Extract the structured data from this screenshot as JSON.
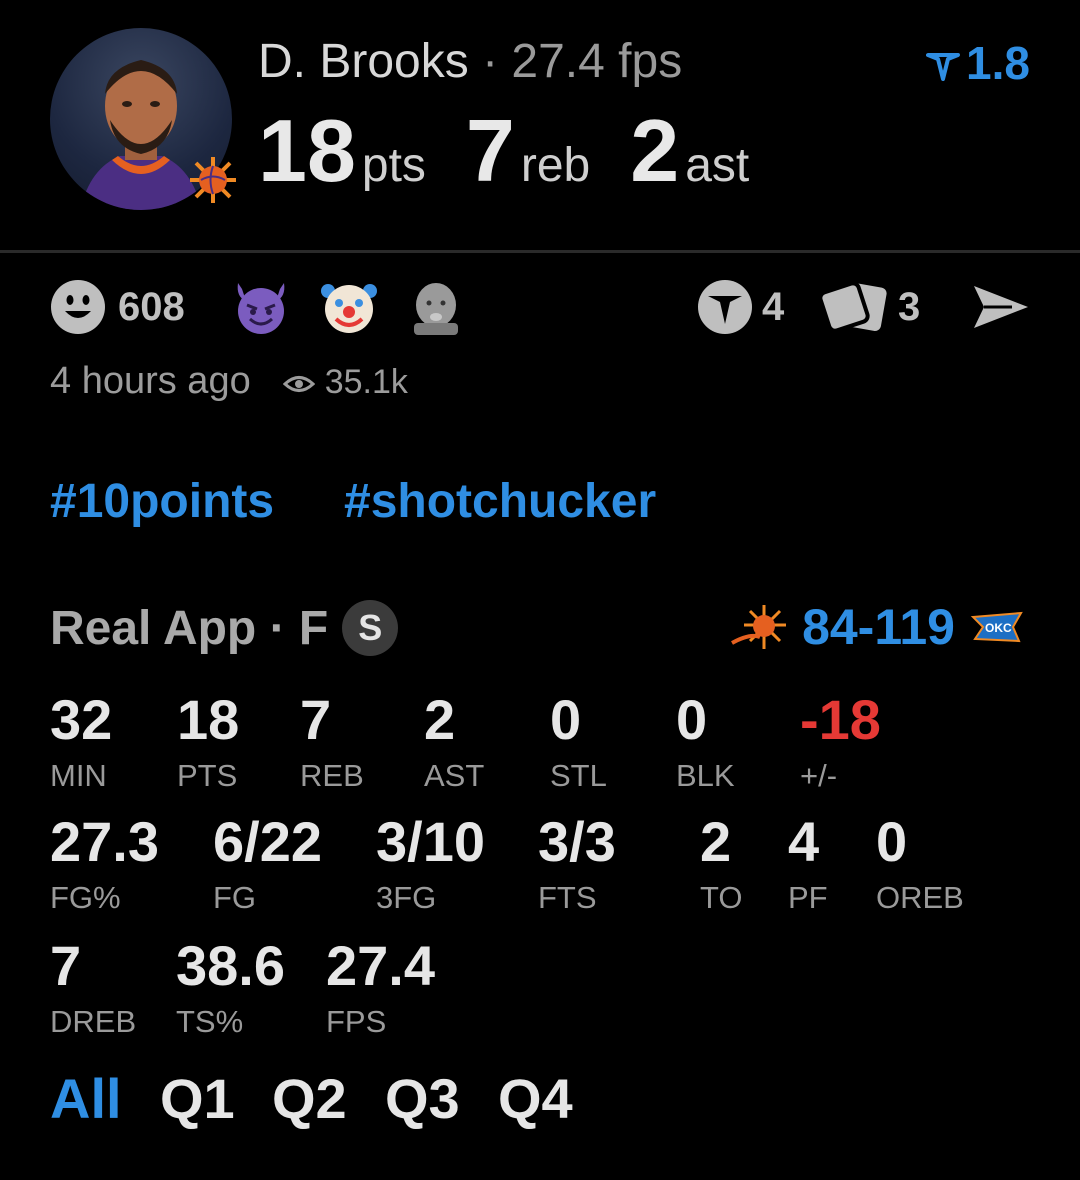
{
  "header": {
    "player_name": "D. Brooks",
    "separator": "·",
    "fps_text": "27.4 fps",
    "rating": "1.8",
    "points": "18",
    "points_unit": "pts",
    "rebounds": "7",
    "rebounds_unit": "reb",
    "assists": "2",
    "assists_unit": "ast"
  },
  "reactions": {
    "smile_count": "608",
    "emojis": [
      "devil-emoji",
      "clown-emoji",
      "baby-emoji"
    ],
    "comments_count": "4",
    "cards_count": "3"
  },
  "meta": {
    "time_ago": "4 hours ago",
    "views": "35.1k"
  },
  "hashtags": [
    "#10points",
    "#shotchucker"
  ],
  "game": {
    "source": "Real App · F",
    "badge": "S",
    "score": "84-119",
    "home_team": "phoenix-suns-logo",
    "away_team": "okc-thunder-logo"
  },
  "stats": [
    {
      "value": "32",
      "label": "MIN"
    },
    {
      "value": "18",
      "label": "PTS"
    },
    {
      "value": "7",
      "label": "REB"
    },
    {
      "value": "2",
      "label": "AST"
    },
    {
      "value": "0",
      "label": "STL"
    },
    {
      "value": "0",
      "label": "BLK"
    },
    {
      "value": "-18",
      "label": "+/-"
    },
    {
      "value": "27.3",
      "label": "FG%"
    },
    {
      "value": "6/22",
      "label": "FG"
    },
    {
      "value": "3/10",
      "label": "3FG"
    },
    {
      "value": "3/3",
      "label": "FTS"
    },
    {
      "value": "2",
      "label": "TO"
    },
    {
      "value": "4",
      "label": "PF"
    },
    {
      "value": "0",
      "label": "OREB"
    },
    {
      "value": "7",
      "label": "DREB"
    },
    {
      "value": "38.6",
      "label": "TS%"
    },
    {
      "value": "27.4",
      "label": "FPS"
    }
  ],
  "periods": [
    "All",
    "Q1",
    "Q2",
    "Q3",
    "Q4"
  ],
  "colors": {
    "accent": "#2f8ee3",
    "negative": "#e53935",
    "background": "#000000"
  }
}
